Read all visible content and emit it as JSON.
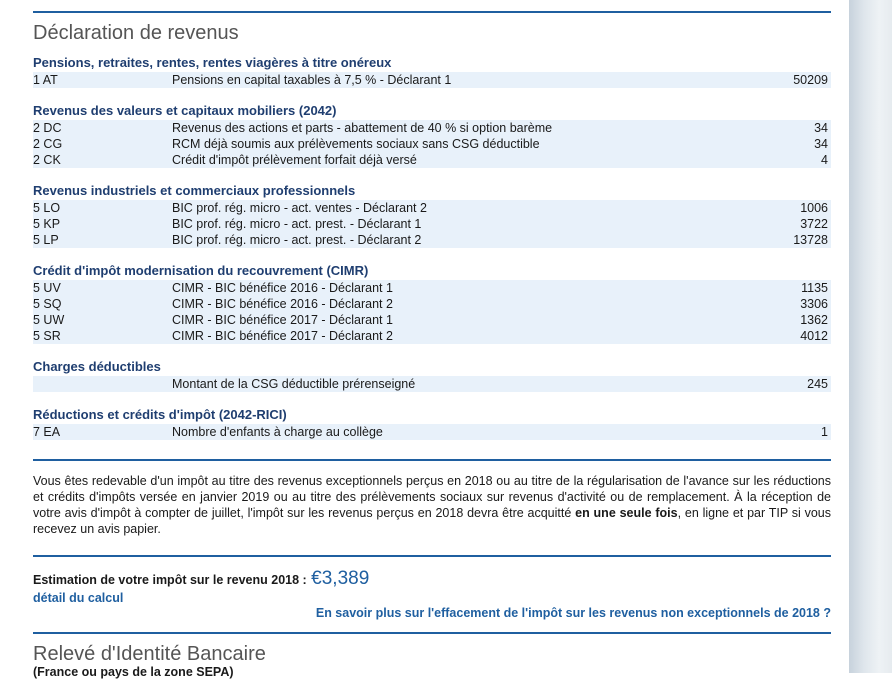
{
  "title": "Déclaration de revenus",
  "sections": [
    {
      "title": "Pensions, retraites, rentes, rentes viagères à titre onéreux",
      "rows": [
        {
          "code": "1 AT",
          "label": "Pensions en capital taxables à 7,5 % - Déclarant 1",
          "value": "50209"
        }
      ]
    },
    {
      "title": "Revenus des valeurs et capitaux mobiliers (2042)",
      "rows": [
        {
          "code": "2 DC",
          "label": "Revenus des actions et parts - abattement de 40 % si option barème",
          "value": "34"
        },
        {
          "code": "2 CG",
          "label": "RCM déjà soumis aux prélèvements sociaux sans CSG déductible",
          "value": "34"
        },
        {
          "code": "2 CK",
          "label": "Crédit d'impôt prélèvement forfait déjà versé",
          "value": "4"
        }
      ]
    },
    {
      "title": "Revenus industriels et commerciaux professionnels",
      "rows": [
        {
          "code": "5 LO",
          "label": "BIC prof. rég. micro - act. ventes - Déclarant 2",
          "value": "1006"
        },
        {
          "code": "5 KP",
          "label": "BIC prof. rég. micro - act. prest. - Déclarant 1",
          "value": "3722"
        },
        {
          "code": "5 LP",
          "label": "BIC prof. rég. micro - act. prest. - Déclarant 2",
          "value": "13728"
        }
      ]
    },
    {
      "title": "Crédit d'impôt modernisation du recouvrement (CIMR)",
      "rows": [
        {
          "code": "5 UV",
          "label": "CIMR - BIC bénéfice 2016 - Déclarant 1",
          "value": "1135"
        },
        {
          "code": "5 SQ",
          "label": "CIMR - BIC bénéfice 2016 - Déclarant 2",
          "value": "3306"
        },
        {
          "code": "5 UW",
          "label": "CIMR - BIC bénéfice 2017 - Déclarant 1",
          "value": "1362"
        },
        {
          "code": "5 SR",
          "label": "CIMR - BIC bénéfice 2017 - Déclarant 2",
          "value": "4012"
        }
      ]
    },
    {
      "title": "Charges déductibles",
      "rows": [
        {
          "code": "",
          "label": "Montant de la CSG déductible prérenseigné",
          "value": "245"
        }
      ]
    },
    {
      "title": "Réductions et crédits d'impôt (2042-RICI)",
      "rows": [
        {
          "code": "7 EA",
          "label": "Nombre d'enfants à charge au collège",
          "value": "1"
        }
      ]
    }
  ],
  "info": {
    "text_before": "Vous êtes redevable d'un impôt au titre des revenus exceptionnels perçus en 2018 ou au titre de la régularisation de l'avance sur les réductions et crédits d'impôts versée en janvier 2019 ou au titre des prélèvements sociaux sur revenus d'activité ou de remplacement. À la réception de votre avis d'impôt à compter de juillet, l'impôt sur les revenus perçus en 2018 devra être acquitté ",
    "text_bold": "en une seule fois",
    "text_after": ", en ligne et par TIP si vous recevez un avis papier."
  },
  "estimation": {
    "label": "Estimation de votre impôt sur le revenu 2018 :",
    "amount": "€3,389",
    "detail_link": "détail du calcul",
    "more_link": "En savoir plus sur l'effacement de l'impôt sur les revenus non exceptionnels de 2018 ?"
  },
  "rib": {
    "title": "Relevé d'Identité Bancaire",
    "subtitle": "(France ou pays de la zone SEPA)"
  }
}
